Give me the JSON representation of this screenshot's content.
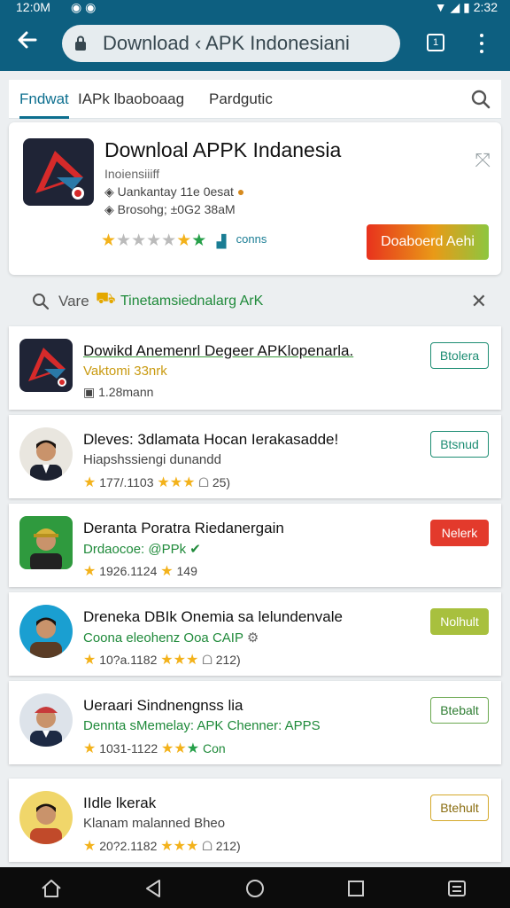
{
  "status": {
    "time": "12:0M",
    "right_time": "2:32"
  },
  "browser": {
    "url": "Download ‹ APK Indonesiani",
    "tab_count": "1"
  },
  "tabs": [
    {
      "label": "Fndwat",
      "active": true
    },
    {
      "label": "IAPk lbaoboaag",
      "active": false
    },
    {
      "label": "Pardgutic",
      "active": false
    }
  ],
  "hero": {
    "title": "Downloal APPK Indanesia",
    "subtitle": "Inoiensiiiff",
    "line2": "Uankantay 11e 0esat",
    "line3": "Brosohg; ±0G2 38aM",
    "stars": "★★★★★★★",
    "rating_label": "conns",
    "download_label": "Doaboerd Aehi"
  },
  "filter": {
    "label": "Vare",
    "text": "Tinetamsiednalarg ArK"
  },
  "list": [
    {
      "line1": "Dowikd Anemenrl Degeer APKlopenarla.",
      "line2": "Vaktomi 33nrk",
      "line3": "1.28mann",
      "button": "Btolera",
      "style": "outline-teal"
    },
    {
      "line1": "Dleves: 3dlamata Hocan Ierakasadde!",
      "line2": "Hiapshssiengi dunandd",
      "line3": "177/.1103",
      "line3b": "25)",
      "button": "Btsnud",
      "style": "outline-teal"
    },
    {
      "line1": "Deranta Poratra Riedanergain",
      "line2": "Drdaocoe: @PPk",
      "line3": "1926.1124",
      "line3b": "149",
      "button": "Nelerk",
      "style": "red"
    },
    {
      "line1": "Dreneka DBIk Onemia sa lelundenvale",
      "line2": "Coona eleohenz Ooa CAIP",
      "line3": "10?a.1182",
      "line3b": "212)",
      "button": "Nolhult",
      "style": "olive"
    },
    {
      "line1": "Ueraari Sindnengnss lia",
      "line2": "Dennta sMemelay: APK Chenner: APPS",
      "line3": "1031-1122",
      "line3b": "Con",
      "button": "Btebalt",
      "style": "outline-green"
    },
    {
      "line1": "IIdle lkerak",
      "line2": "Klanam malanned Bheo",
      "line3": "20?2.1182",
      "line3b": "212)",
      "button": "Btehult",
      "style": "outline-gold"
    }
  ],
  "colors": {
    "appbar": "#0d5f80",
    "accent": "#0d6f8f",
    "star": "#f3b21b",
    "navbar": "#0c0c0c"
  }
}
